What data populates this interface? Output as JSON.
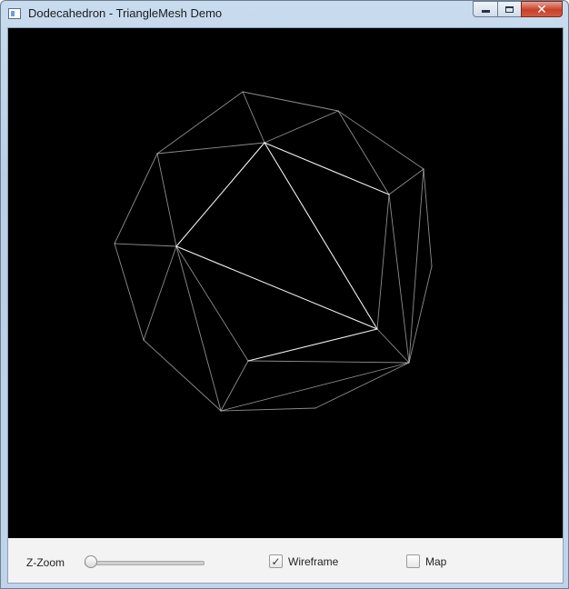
{
  "window": {
    "title": "Dodecahedron - TriangleMesh Demo",
    "icon": "app-window-icon",
    "controls": {
      "minimize_icon": "minimize-icon",
      "maximize_icon": "maximize-icon",
      "close_icon": "close-icon"
    }
  },
  "viewport": {
    "background": "#000000",
    "wireframe_color": "#d8d8d8",
    "mesh": "dodecahedron"
  },
  "controls": {
    "zoom_label": "Z-Zoom",
    "zoom_value_fraction": 0.05,
    "wireframe": {
      "label": "Wireframe",
      "checked": true,
      "check_glyph": "✓"
    },
    "map": {
      "label": "Map",
      "checked": false,
      "check_glyph": ""
    }
  }
}
